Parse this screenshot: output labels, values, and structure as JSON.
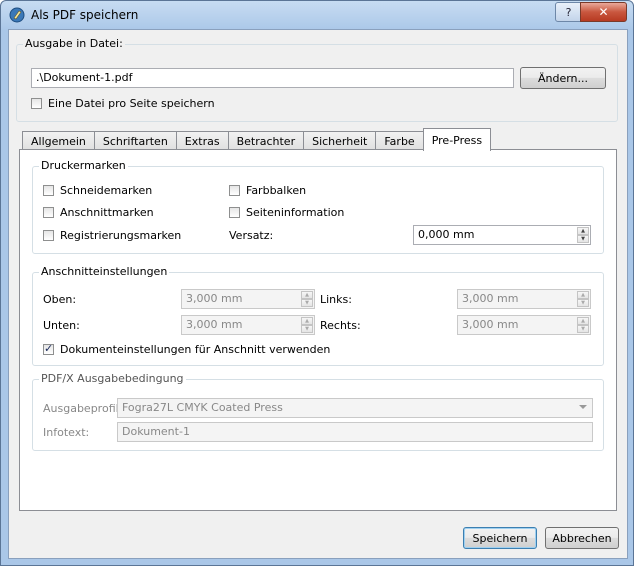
{
  "window": {
    "title": "Als PDF speichern",
    "help_label": "?",
    "close_label": "✕"
  },
  "output": {
    "group_title": "Ausgabe in Datei:",
    "file_path": ".\\Dokument-1.pdf",
    "change_button": "Ändern...",
    "one_file_per_page": "Eine Datei pro Seite speichern"
  },
  "tabs": [
    "Allgemein",
    "Schriftarten",
    "Extras",
    "Betrachter",
    "Sicherheit",
    "Farbe",
    "Pre-Press"
  ],
  "active_tab": "Pre-Press",
  "printer_marks": {
    "title": "Druckermarken",
    "crop_marks": "Schneidemarken",
    "bleed_marks": "Anschnittmarken",
    "registration_marks": "Registrierungsmarken",
    "color_bars": "Farbbalken",
    "page_info": "Seiteninformation",
    "offset_label": "Versatz:",
    "offset_value": "0,000 mm"
  },
  "bleed": {
    "title": "Anschnitteinstellungen",
    "top_label": "Oben:",
    "top_value": "3,000 mm",
    "bottom_label": "Unten:",
    "bottom_value": "3,000 mm",
    "left_label": "Links:",
    "left_value": "3,000 mm",
    "right_label": "Rechts:",
    "right_value": "3,000 mm",
    "use_doc_settings": "Dokumenteinstellungen für Anschnitt verwenden"
  },
  "pdfx": {
    "title": "PDF/X Ausgabebedingung",
    "profile_label": "Ausgabeprofil:",
    "profile_value": "Fogra27L CMYK Coated Press",
    "info_label": "Infotext:",
    "info_value": "Dokument-1"
  },
  "buttons": {
    "save": "Speichern",
    "cancel": "Abbrechen"
  }
}
